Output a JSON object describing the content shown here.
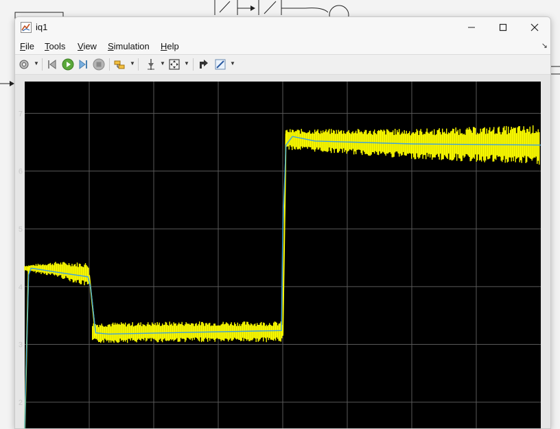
{
  "window": {
    "title": "iq1",
    "minimize_icon": "minimize-icon",
    "maximize_icon": "maximize-icon",
    "close_icon": "close-icon"
  },
  "menu": {
    "items": [
      {
        "label": "File",
        "mnemonic": "F",
        "rest": "ile"
      },
      {
        "label": "Tools",
        "mnemonic": "T",
        "rest": "ools"
      },
      {
        "label": "View",
        "mnemonic": "V",
        "rest": "iew"
      },
      {
        "label": "Simulation",
        "mnemonic": "S",
        "rest": "imulation"
      },
      {
        "label": "Help",
        "mnemonic": "H",
        "rest": "elp"
      }
    ]
  },
  "toolbar": {
    "buttons": [
      "settings-icon",
      "step-back-icon",
      "run-icon",
      "step-forward-icon",
      "stop-icon",
      "highlight-block-icon",
      "cursor-measure-icon",
      "zoom-fit-icon",
      "restore-layout-icon",
      "style-icon"
    ]
  },
  "colors": {
    "plot_background": "#000000",
    "grid": "#5a5a5a",
    "signal_raw": "#ffff00",
    "signal_filtered": "#3aa0e0",
    "tick_label": "#c8c8c8"
  },
  "chart_data": {
    "type": "line",
    "title": "",
    "xlabel": "",
    "ylabel": "",
    "yticks": [
      "2",
      "3",
      "4",
      "5",
      "6",
      "7"
    ],
    "ylim": [
      1.5,
      7.55
    ],
    "xlim": [
      0,
      8
    ],
    "grid": true,
    "series": [
      {
        "color": "#ffff00",
        "style": "noisy band",
        "segments": [
          {
            "x": [
              0,
              0.1,
              1.0
            ],
            "y_center": [
              4.32,
              4.3,
              4.2
            ],
            "band": [
              0.05,
              0.22
            ]
          },
          {
            "x": [
              1.05,
              2.8,
              4.0
            ],
            "y_center": [
              3.2,
              3.22,
              3.22
            ],
            "band": [
              0.18,
              0.18
            ]
          },
          {
            "x": [
              4.05,
              6.0,
              8.0
            ],
            "y_center": [
              6.55,
              6.47,
              6.45
            ],
            "band": [
              0.18,
              0.35
            ]
          }
        ]
      },
      {
        "color": "#3aa0e0",
        "style": "mean line",
        "x": [
          0,
          0.02,
          0.06,
          0.1,
          0.5,
          0.98,
          1.02,
          1.1,
          1.3,
          3.98,
          4.0,
          4.05,
          4.15,
          4.5,
          6.0,
          8.0
        ],
        "y": [
          1.5,
          2.5,
          4.2,
          4.32,
          4.25,
          4.17,
          4.0,
          3.2,
          3.18,
          3.24,
          5.0,
          6.45,
          6.6,
          6.52,
          6.47,
          6.45
        ]
      }
    ]
  }
}
